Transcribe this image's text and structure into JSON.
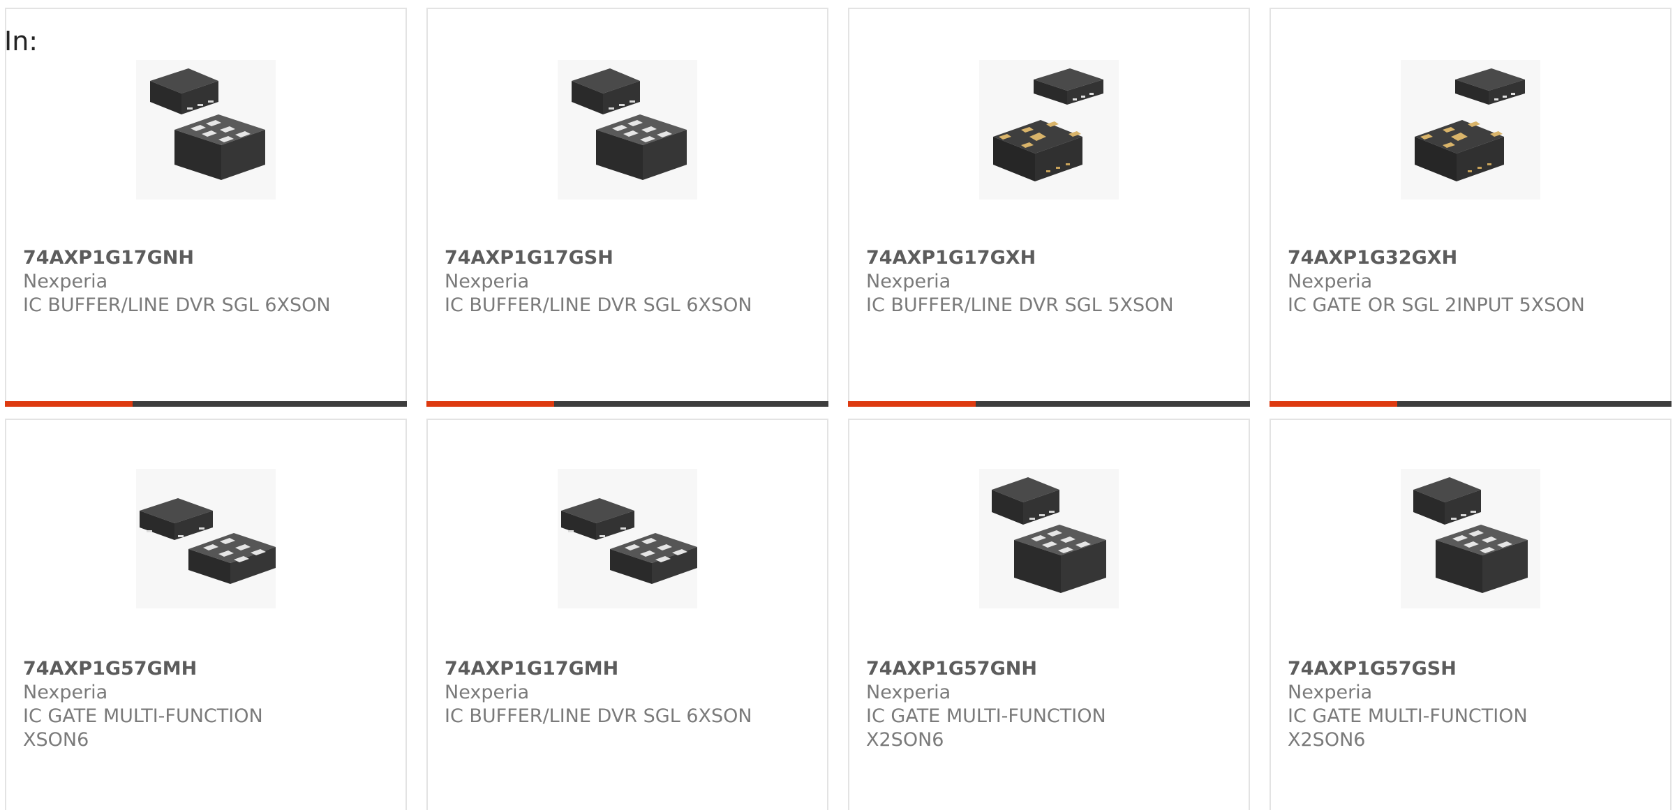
{
  "header": {
    "label": "In:"
  },
  "colors": {
    "accent": "#dd3a10",
    "bar_track": "#3d3d3d",
    "card_border": "#e3e3e3",
    "text_muted": "#7a7a7a"
  },
  "products": [
    {
      "part": "74AXP1G17GNH",
      "manufacturer": "Nexperia",
      "description": "IC BUFFER/LINE DVR SGL 6XSON",
      "image": "6-pin-xson-package-image"
    },
    {
      "part": "74AXP1G17GSH",
      "manufacturer": "Nexperia",
      "description": "IC BUFFER/LINE DVR SGL 6XSON",
      "image": "6-pin-xson-package-image"
    },
    {
      "part": "74AXP1G17GXH",
      "manufacturer": "Nexperia",
      "description": "IC BUFFER/LINE DVR SGL 5XSON",
      "image": "5-pin-xson-package-image"
    },
    {
      "part": "74AXP1G32GXH",
      "manufacturer": "Nexperia",
      "description": "IC GATE OR SGL 2INPUT 5XSON",
      "image": "5-pin-xson-package-image"
    },
    {
      "part": "74AXP1G57GMH",
      "manufacturer": "Nexperia",
      "description": "IC GATE MULTI-FUNCTION\nXSON6",
      "image": "6-pin-xson-package-image"
    },
    {
      "part": "74AXP1G17GMH",
      "manufacturer": "Nexperia",
      "description": "IC BUFFER/LINE DVR SGL 6XSON",
      "image": "6-pin-xson-package-image"
    },
    {
      "part": "74AXP1G57GNH",
      "manufacturer": "Nexperia",
      "description": "IC GATE MULTI-FUNCTION\nX2SON6",
      "image": "6-pin-x2son-package-image"
    },
    {
      "part": "74AXP1G57GSH",
      "manufacturer": "Nexperia",
      "description": "IC GATE MULTI-FUNCTION\nX2SON6",
      "image": "6-pin-x2son-package-image"
    }
  ]
}
